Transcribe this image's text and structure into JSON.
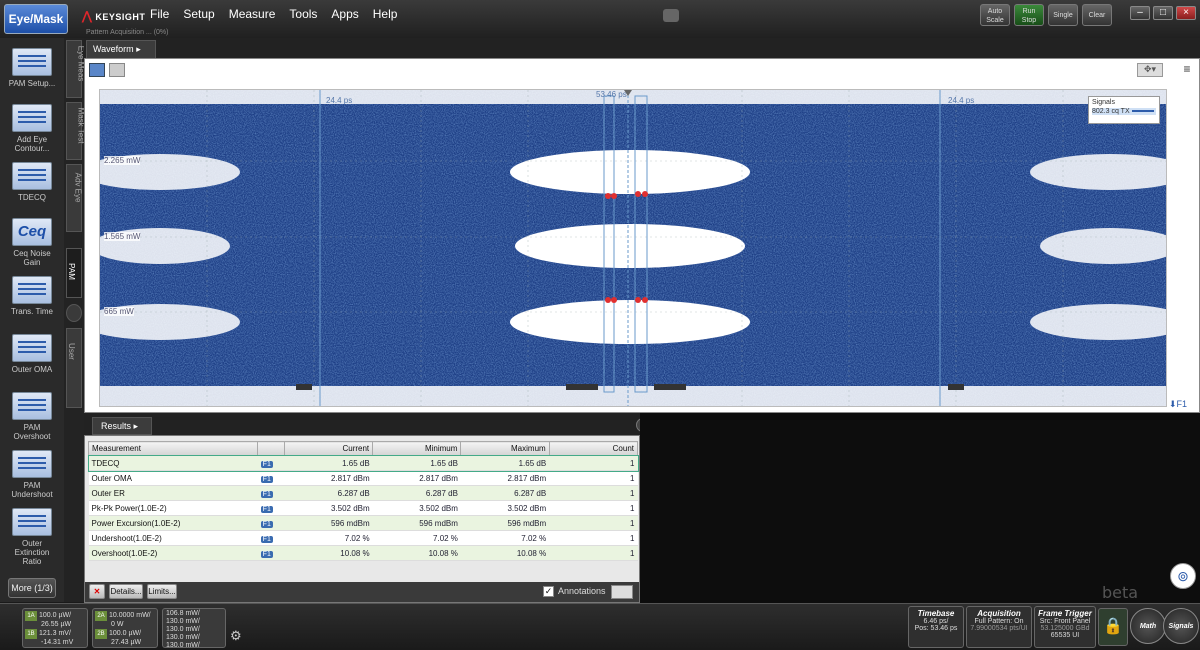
{
  "title_bar": {
    "mode_button": "Eye/Mask",
    "brand": "KEYSIGHT",
    "menu": [
      "File",
      "Setup",
      "Measure",
      "Tools",
      "Apps",
      "Help"
    ],
    "sub_caption": "Pattern Acquisition ... (0%)",
    "buttons": {
      "auto_scale": "Auto Scale",
      "run_stop": "Run Stop",
      "single": "Single",
      "clear": "Clear"
    }
  },
  "tools": [
    {
      "label": "PAM Setup..."
    },
    {
      "label": "Add Eye Contour..."
    },
    {
      "label": "TDECQ"
    },
    {
      "label": "Ceq Noise Gain",
      "glyph": "Ceq"
    },
    {
      "label": "Trans. Time"
    },
    {
      "label": "Outer OMA"
    },
    {
      "label": "PAM Overshoot"
    },
    {
      "label": "PAM Undershoot"
    },
    {
      "label": "Outer Extinction Ratio"
    }
  ],
  "more_button": "More (1/3)",
  "vertical_tabs": [
    "Eye Meas",
    "Mask Test",
    "Adv Eye",
    "PAM",
    "User"
  ],
  "waveform": {
    "tab_label": "Waveform",
    "markers": [
      "24.4 ps",
      "53.46 ps",
      "24.4 ps"
    ],
    "levels": [
      "2.265 mW",
      "1.565 mW",
      "665 mW"
    ],
    "legend_title": "Signals",
    "legend_entry": "802.3 cq TX",
    "channel_tag": "F1"
  },
  "results": {
    "tab_label": "Results",
    "columns": [
      "Measurement",
      "",
      "Current",
      "Minimum",
      "Maximum",
      "Count"
    ],
    "rows": [
      {
        "name": "TDECQ",
        "src": "F1",
        "current": "1.65 dB",
        "minimum": "1.65 dB",
        "maximum": "1.65 dB",
        "count": "1"
      },
      {
        "name": "Outer OMA",
        "src": "F1",
        "current": "2.817 dBm",
        "minimum": "2.817 dBm",
        "maximum": "2.817 dBm",
        "count": "1"
      },
      {
        "name": "Outer ER",
        "src": "F1",
        "current": "6.287 dB",
        "minimum": "6.287 dB",
        "maximum": "6.287 dB",
        "count": "1"
      },
      {
        "name": "Pk-Pk Power(1.0E-2)",
        "src": "F1",
        "current": "3.502 dBm",
        "minimum": "3.502 dBm",
        "maximum": "3.502 dBm",
        "count": "1"
      },
      {
        "name": "Power Excursion(1.0E-2)",
        "src": "F1",
        "current": "596 mdBm",
        "minimum": "596 mdBm",
        "maximum": "596 mdBm",
        "count": "1"
      },
      {
        "name": "Undershoot(1.0E-2)",
        "src": "F1",
        "current": "7.02 %",
        "minimum": "7.02 %",
        "maximum": "7.02 %",
        "count": "1"
      },
      {
        "name": "Overshoot(1.0E-2)",
        "src": "F1",
        "current": "10.08 %",
        "minimum": "10.08 %",
        "maximum": "10.08 %",
        "count": "1"
      }
    ],
    "details_button": "Details...",
    "limits_button": "Limits...",
    "annotations_label": "Annotations",
    "annotations_checked": true
  },
  "status": {
    "ch1a": {
      "tag": "1A",
      "line1": "100.0 µW/",
      "line2": "26.55 µW"
    },
    "ch1b": {
      "tag": "1B",
      "line1": "121.3 mV/",
      "line2": "-14.31 mV"
    },
    "ch2a": {
      "tag": "2A",
      "line1": "10.0000 mW/",
      "line2": "0 W"
    },
    "ch2b": {
      "tag": "2B",
      "line1": "100.0 µW/",
      "line2": "27.43 µW"
    },
    "fn": [
      "106.8 mW/",
      "130.0 mW/",
      "130.0 mW/",
      "130.0 mW/",
      "130.0 mW/"
    ],
    "timebase": {
      "title": "Timebase",
      "line1": "6.46 ps/",
      "line2": "Pos: 53.46 ps"
    },
    "acquisition": {
      "title": "Acquisition",
      "line1": "Full Pattern: On",
      "line2": "7.99000534 pts/UI"
    },
    "frame_trigger": {
      "title": "Frame Trigger",
      "line1": "Src: Front Panel",
      "line2": "53.125000 GBd",
      "line3": "65535 UI"
    },
    "math": "Math",
    "signals": "Signals",
    "watermark": "beta"
  }
}
